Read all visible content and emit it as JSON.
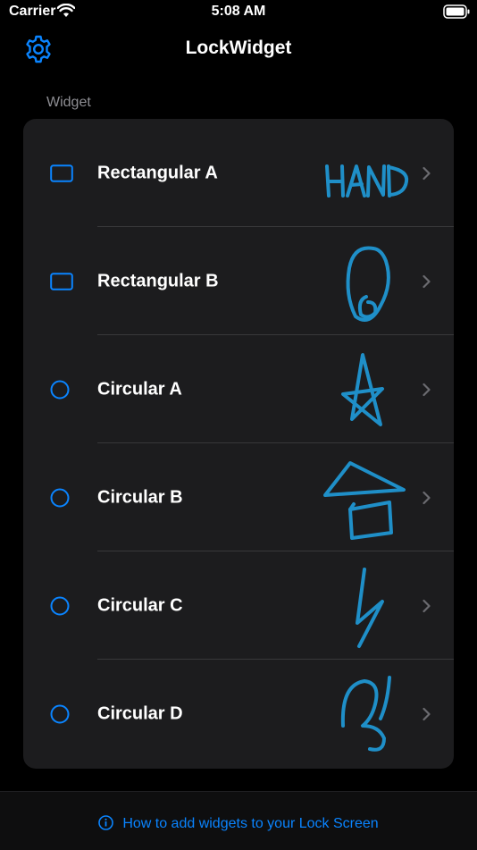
{
  "status": {
    "carrier": "Carrier",
    "time": "5:08 AM"
  },
  "nav": {
    "title": "LockWidget"
  },
  "section": {
    "header": "Widget"
  },
  "widgets": [
    {
      "label": "Rectangular A",
      "shape": "rect",
      "preview": "HAND"
    },
    {
      "label": "Rectangular B",
      "shape": "rect",
      "preview": "loop"
    },
    {
      "label": "Circular A",
      "shape": "circle",
      "preview": "star"
    },
    {
      "label": "Circular B",
      "shape": "circle",
      "preview": "house"
    },
    {
      "label": "Circular C",
      "shape": "circle",
      "preview": "bolt"
    },
    {
      "label": "Circular D",
      "shape": "circle",
      "preview": "scribble"
    }
  ],
  "footer": {
    "help_text": "How to add widgets to your Lock Screen"
  },
  "colors": {
    "accent": "#0a84ff",
    "ink": "#1f8fc8",
    "card": "#1c1c1e",
    "background": "#000000"
  }
}
